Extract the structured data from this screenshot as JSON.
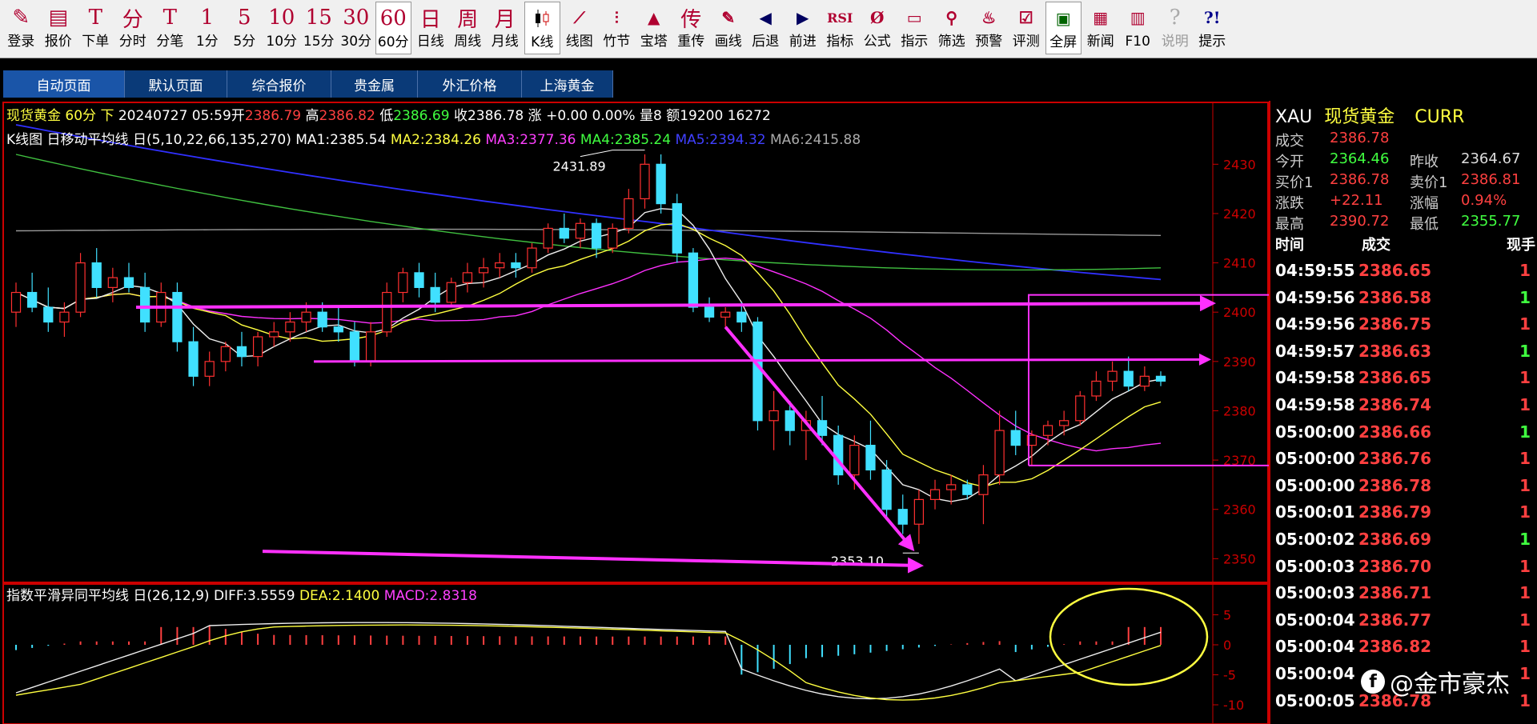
{
  "toolbar": {
    "items": [
      {
        "icon": "pencil-icon",
        "glyph": "✎",
        "label": "登录"
      },
      {
        "icon": "quote-icon",
        "glyph": "▤",
        "label": "报价"
      },
      {
        "icon": "order-icon",
        "glyph": "T",
        "label": "下单"
      },
      {
        "icon": "text-icon",
        "glyph": "分",
        "label": "分时"
      },
      {
        "icon": "text-icon",
        "glyph": "T",
        "label": "分笔"
      },
      {
        "icon": "text-icon",
        "glyph": "1",
        "label": "1分"
      },
      {
        "icon": "text-icon",
        "glyph": "5",
        "label": "5分"
      },
      {
        "icon": "text-icon",
        "glyph": "10",
        "label": "10分"
      },
      {
        "icon": "text-icon",
        "glyph": "15",
        "label": "15分"
      },
      {
        "icon": "text-icon",
        "glyph": "30",
        "label": "30分"
      },
      {
        "icon": "text-icon",
        "glyph": "60",
        "label": "60分",
        "active": true
      },
      {
        "icon": "text-icon",
        "glyph": "日",
        "label": "日线"
      },
      {
        "icon": "text-icon",
        "glyph": "周",
        "label": "周线"
      },
      {
        "icon": "text-icon",
        "glyph": "月",
        "label": "月线"
      },
      {
        "icon": "candle-icon",
        "glyph": "",
        "label": "K线",
        "active": true
      },
      {
        "icon": "line-chart-icon",
        "glyph": "⟋",
        "label": "线图"
      },
      {
        "icon": "bamboo-icon",
        "glyph": "⫶",
        "label": "竹节"
      },
      {
        "icon": "tower-icon",
        "glyph": "▲",
        "label": "宝塔"
      },
      {
        "icon": "text-icon",
        "glyph": "传",
        "label": "重传"
      },
      {
        "icon": "draw-icon",
        "glyph": "✎",
        "label": "画线"
      },
      {
        "icon": "back-icon",
        "glyph": "◀",
        "label": "后退"
      },
      {
        "icon": "forward-icon",
        "glyph": "▶",
        "label": "前进"
      },
      {
        "icon": "rsi-icon",
        "glyph": "RSI",
        "label": "指标"
      },
      {
        "icon": "formula-icon",
        "glyph": "Ø",
        "label": "公式"
      },
      {
        "icon": "indicator-icon",
        "glyph": "▭",
        "label": "指示"
      },
      {
        "icon": "filter-icon",
        "glyph": "⚲",
        "label": "筛选"
      },
      {
        "icon": "alarm-icon",
        "glyph": "♨",
        "label": "预警"
      },
      {
        "icon": "test-icon",
        "glyph": "☑",
        "label": "评测"
      },
      {
        "icon": "fullscreen-icon",
        "glyph": "▣",
        "label": "全屏",
        "active": true
      },
      {
        "icon": "news-icon",
        "glyph": "▦",
        "label": "新闻"
      },
      {
        "icon": "books-icon",
        "glyph": "▥",
        "label": "F10"
      },
      {
        "icon": "help-icon",
        "glyph": "?",
        "label": "说明"
      },
      {
        "icon": "hint-icon",
        "glyph": "?!",
        "label": "提示"
      }
    ]
  },
  "tabs": [
    {
      "label": "自动页面",
      "active": true
    },
    {
      "label": "默认页面"
    },
    {
      "label": "综合报价"
    },
    {
      "label": "贵金属"
    },
    {
      "label": "外汇价格"
    },
    {
      "label": "上海黄金"
    }
  ],
  "info": {
    "name": "现货黄金 60分 下",
    "date": "20240727 05:59",
    "open_label": "开",
    "open": "2386.79",
    "high_label": "高",
    "high": "2386.82",
    "low_label": "低",
    "low": "2386.69",
    "close_label": "收",
    "close": "2386.78",
    "change_label": "涨",
    "change": "+0.00 0.00%",
    "vol_label": "量",
    "vol": "8",
    "amt_label": "额",
    "amt": "19200 16272"
  },
  "ma": {
    "prefix": "K线图 日移动平均线 日(5,10,22,66,135,270)",
    "ma1": "MA1:2385.54",
    "ma2": "MA2:2384.26",
    "ma3": "MA3:2377.36",
    "ma4": "MA4:2385.24",
    "ma5": "MA5:2394.32",
    "ma6": "MA6:2415.88"
  },
  "macd": {
    "prefix": "指数平滑异同平均线 日(26,12,9)",
    "diff": "DIFF:3.5559",
    "dea": "DEA:2.1400",
    "macd": "MACD:2.8318"
  },
  "chart_data": {
    "type": "candlestick",
    "y_ticks": [
      2350,
      2360,
      2370,
      2380,
      2390,
      2400,
      2410,
      2420,
      2430
    ],
    "ylim": [
      2346,
      2438
    ],
    "macd_ticks": [
      "5",
      "0",
      "-5",
      "-10"
    ],
    "annotations": {
      "high": "2431.89",
      "low": "2353.10"
    },
    "candles": [
      [
        2400,
        2406,
        2397,
        2404
      ],
      [
        2404,
        2408,
        2400,
        2401
      ],
      [
        2401,
        2405,
        2396,
        2398
      ],
      [
        2398,
        2402,
        2395,
        2400
      ],
      [
        2400,
        2412,
        2399,
        2410
      ],
      [
        2410,
        2413,
        2403,
        2405
      ],
      [
        2405,
        2409,
        2402,
        2407
      ],
      [
        2407,
        2410,
        2404,
        2405
      ],
      [
        2405,
        2408,
        2396,
        2398
      ],
      [
        2398,
        2406,
        2397,
        2404
      ],
      [
        2404,
        2406,
        2392,
        2394
      ],
      [
        2394,
        2397,
        2385,
        2387
      ],
      [
        2387,
        2392,
        2385,
        2390
      ],
      [
        2390,
        2394,
        2388,
        2393
      ],
      [
        2393,
        2396,
        2389,
        2391
      ],
      [
        2391,
        2396,
        2389,
        2395
      ],
      [
        2395,
        2398,
        2393,
        2396
      ],
      [
        2396,
        2400,
        2394,
        2398
      ],
      [
        2398,
        2402,
        2396,
        2400
      ],
      [
        2400,
        2402,
        2396,
        2397
      ],
      [
        2397,
        2401,
        2394,
        2396
      ],
      [
        2396,
        2398,
        2389,
        2390
      ],
      [
        2390,
        2398,
        2389,
        2396
      ],
      [
        2396,
        2406,
        2395,
        2404
      ],
      [
        2404,
        2409,
        2402,
        2408
      ],
      [
        2408,
        2410,
        2403,
        2405
      ],
      [
        2405,
        2408,
        2400,
        2402
      ],
      [
        2402,
        2407,
        2401,
        2406
      ],
      [
        2406,
        2410,
        2404,
        2408
      ],
      [
        2408,
        2411,
        2405,
        2409
      ],
      [
        2409,
        2412,
        2407,
        2410
      ],
      [
        2410,
        2412,
        2407,
        2409
      ],
      [
        2409,
        2414,
        2408,
        2413
      ],
      [
        2413,
        2418,
        2412,
        2417
      ],
      [
        2417,
        2420,
        2414,
        2415
      ],
      [
        2415,
        2419,
        2413,
        2418
      ],
      [
        2418,
        2419,
        2411,
        2413
      ],
      [
        2413,
        2418,
        2412,
        2417
      ],
      [
        2417,
        2425,
        2416,
        2423
      ],
      [
        2423,
        2432,
        2421,
        2430
      ],
      [
        2430,
        2432,
        2420,
        2422
      ],
      [
        2422,
        2424,
        2410,
        2412
      ],
      [
        2412,
        2413,
        2400,
        2401
      ],
      [
        2401,
        2403,
        2398,
        2399
      ],
      [
        2399,
        2401,
        2397,
        2400
      ],
      [
        2400,
        2402,
        2396,
        2398
      ],
      [
        2398,
        2399,
        2376,
        2378
      ],
      [
        2378,
        2384,
        2372,
        2380
      ],
      [
        2380,
        2382,
        2373,
        2376
      ],
      [
        2376,
        2380,
        2370,
        2378
      ],
      [
        2378,
        2383,
        2373,
        2375
      ],
      [
        2375,
        2377,
        2365,
        2367
      ],
      [
        2367,
        2375,
        2364,
        2373
      ],
      [
        2373,
        2378,
        2366,
        2368
      ],
      [
        2368,
        2370,
        2358,
        2360
      ],
      [
        2360,
        2363,
        2355,
        2357
      ],
      [
        2357,
        2364,
        2353,
        2362
      ],
      [
        2362,
        2366,
        2360,
        2364
      ],
      [
        2364,
        2367,
        2361,
        2365
      ],
      [
        2365,
        2366,
        2362,
        2363
      ],
      [
        2363,
        2369,
        2357,
        2367
      ],
      [
        2367,
        2380,
        2365,
        2376
      ],
      [
        2376,
        2380,
        2371,
        2373
      ],
      [
        2373,
        2376,
        2369,
        2375
      ],
      [
        2375,
        2378,
        2373,
        2377
      ],
      [
        2377,
        2380,
        2375,
        2378
      ],
      [
        2378,
        2384,
        2377,
        2383
      ],
      [
        2383,
        2388,
        2382,
        2386
      ],
      [
        2386,
        2390,
        2384,
        2388
      ],
      [
        2388,
        2391,
        2384,
        2385
      ],
      [
        2385,
        2389,
        2384,
        2387
      ],
      [
        2387,
        2388,
        2385,
        2386
      ]
    ]
  },
  "panel": {
    "header": {
      "code": "XAU",
      "name": "现货黄金",
      "tag": "CURR"
    },
    "deal_label": "成交",
    "deal": "2386.78",
    "stats": [
      {
        "l1": "今开",
        "v1": "2364.46",
        "c1": "#40ff40",
        "l2": "昨收",
        "v2": "2364.67",
        "c2": "#dddddd"
      },
      {
        "l1": "买价1",
        "v1": "2386.78",
        "c1": "#ff4040",
        "l2": "卖价1",
        "v2": "2386.81",
        "c2": "#ff4040"
      },
      {
        "l1": "涨跌",
        "v1": "+22.11",
        "c1": "#ff4040",
        "l2": "涨幅",
        "v2": "0.94%",
        "c2": "#ff4040"
      },
      {
        "l1": "最高",
        "v1": "2390.72",
        "c1": "#ff4040",
        "l2": "最低",
        "v2": "2355.77",
        "c2": "#40ff40"
      }
    ],
    "ticks_header": {
      "time": "时间",
      "price": "成交",
      "vol": "现手"
    },
    "ticks": [
      {
        "time": "04:59:55",
        "price": "2386.65",
        "vol": "1",
        "vc": "#ff4040"
      },
      {
        "time": "04:59:56",
        "price": "2386.58",
        "vol": "1",
        "vc": "#40ff40"
      },
      {
        "time": "04:59:56",
        "price": "2386.75",
        "vol": "1",
        "vc": "#ff4040"
      },
      {
        "time": "04:59:57",
        "price": "2386.63",
        "vol": "1",
        "vc": "#40ff40"
      },
      {
        "time": "04:59:58",
        "price": "2386.65",
        "vol": "1",
        "vc": "#ff4040"
      },
      {
        "time": "04:59:58",
        "price": "2386.74",
        "vol": "1",
        "vc": "#ff4040"
      },
      {
        "time": "05:00:00",
        "price": "2386.66",
        "vol": "1",
        "vc": "#40ff40"
      },
      {
        "time": "05:00:00",
        "price": "2386.76",
        "vol": "1",
        "vc": "#ff4040"
      },
      {
        "time": "05:00:00",
        "price": "2386.78",
        "vol": "1",
        "vc": "#ff4040"
      },
      {
        "time": "05:00:01",
        "price": "2386.79",
        "vol": "1",
        "vc": "#ff4040"
      },
      {
        "time": "05:00:02",
        "price": "2386.69",
        "vol": "1",
        "vc": "#40ff40"
      },
      {
        "time": "05:00:03",
        "price": "2386.70",
        "vol": "1",
        "vc": "#ff4040"
      },
      {
        "time": "05:00:03",
        "price": "2386.71",
        "vol": "1",
        "vc": "#ff4040"
      },
      {
        "time": "05:00:04",
        "price": "2386.77",
        "vol": "1",
        "vc": "#ff4040"
      },
      {
        "time": "05:00:04",
        "price": "2386.82",
        "vol": "1",
        "vc": "#ff4040"
      },
      {
        "time": "05:00:04",
        "price": "",
        "vol": "1",
        "vc": "#ff4040"
      },
      {
        "time": "05:00:05",
        "price": "2386.78",
        "vol": "1",
        "vc": "#ff4040"
      }
    ]
  },
  "watermark": "@金市豪杰",
  "colors": {
    "up": "#ff3030",
    "down": "#40e0ff",
    "magenta": "#ff30ff",
    "yellow": "#ffff40",
    "ma_blue": "#3030ff",
    "ma_green": "#40c040",
    "ma_gray": "#999999"
  }
}
